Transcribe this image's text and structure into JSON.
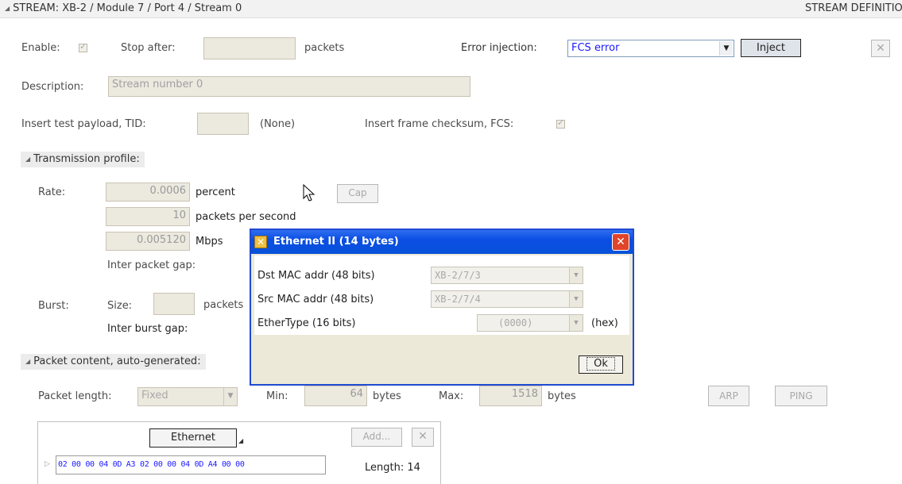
{
  "header": {
    "path": "STREAM: XB-2 / Module 7 / Port 4 / Stream  0",
    "right_title": "STREAM DEFINITION"
  },
  "row1": {
    "enable_label": "Enable:",
    "stop_after_label": "Stop after:",
    "stop_after_value": "",
    "packets_label": "packets",
    "error_injection_label": "Error injection:",
    "error_injection_value": "FCS error",
    "inject_label": "Inject"
  },
  "description": {
    "label": "Description:",
    "placeholder": "Stream number 0"
  },
  "payload": {
    "tid_label": "Insert test payload, TID:",
    "tid_value": "",
    "tid_none": "(None)",
    "fcs_label": "Insert frame checksum, FCS:"
  },
  "transmission": {
    "header": "Transmission profile:",
    "rate_label": "Rate:",
    "percent_value": "0.0006",
    "percent_unit": "percent",
    "pps_value": "10",
    "pps_unit": "packets per second",
    "mbps_value": "0.005120",
    "mbps_unit": "Mbps",
    "cap_label": "Cap",
    "ipg_label": "Inter packet gap:",
    "burst_label": "Burst:",
    "size_label": "Size:",
    "size_value": "",
    "packets_label": "packets",
    "ibg_label": "Inter burst gap:"
  },
  "packet_content": {
    "header": "Packet content, auto-generated:",
    "length_label": "Packet length:",
    "length_mode": "Fixed",
    "min_label": "Min:",
    "min_value": "64",
    "min_unit": "bytes",
    "max_label": "Max:",
    "max_value": "1518",
    "max_unit": "bytes",
    "arp_label": "ARP",
    "ping_label": "PING",
    "segment_label": "Ethernet",
    "add_label": "Add...",
    "hex": "02 00 00 04 0D A3 02 00 00 04 0D A4 00 00",
    "length_text": "Length: 14"
  },
  "dialog": {
    "title": "Ethernet II  (14 bytes)",
    "dst_label": "Dst MAC addr  (48 bits)",
    "dst_value": "XB-2/7/3",
    "src_label": "Src MAC addr  (48 bits)",
    "src_value": "XB-2/7/4",
    "ethertype_label": "EtherType  (16 bits)",
    "ethertype_value": "(0000)",
    "hex_label": "(hex)",
    "ok_label": "Ok"
  },
  "colors": {
    "dialog_title": "#0a4ee4",
    "dialog_close": "#e0442a",
    "hex_text": "#1a1aff"
  },
  "icons": {
    "close": "close-icon",
    "collapse": "collapse-triangle-icon",
    "dialog_app": "dialog-app-icon",
    "cursor": "mouse-cursor-icon"
  }
}
